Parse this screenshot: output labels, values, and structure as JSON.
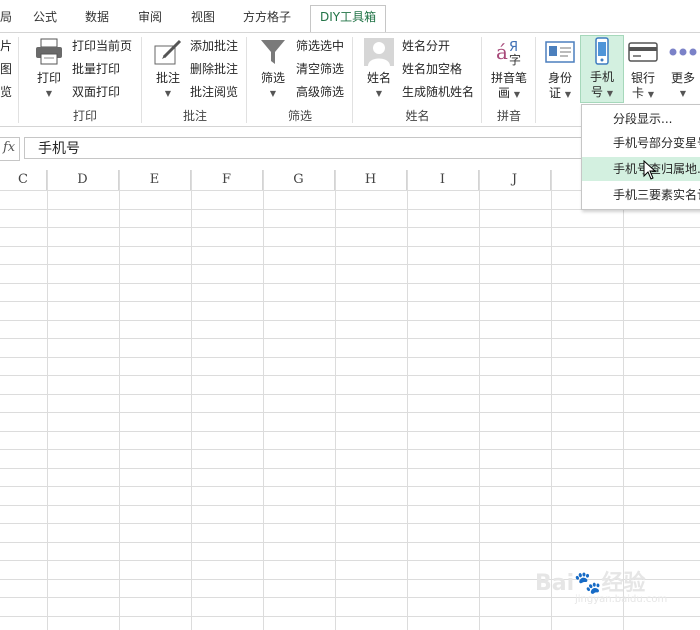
{
  "tabs": [
    "局",
    "公式",
    "数据",
    "审阅",
    "视图",
    "方方格子",
    "DIY工具箱"
  ],
  "ribbon": {
    "partial_items": [
      "片",
      "图",
      "览"
    ],
    "print": {
      "big": "打印",
      "items": [
        "打印当前页",
        "批量打印",
        "双面打印"
      ],
      "group": "打印"
    },
    "comment": {
      "big": "批注",
      "items": [
        "添加批注",
        "删除批注",
        "批注阅览"
      ],
      "group": "批注"
    },
    "filter": {
      "big": "筛选",
      "items": [
        "筛选选中",
        "清空筛选",
        "高级筛选"
      ],
      "group": "筛选"
    },
    "name": {
      "big": "姓名",
      "items": [
        "姓名分开",
        "姓名加空格",
        "生成随机姓名"
      ],
      "group": "姓名"
    },
    "pinyin": {
      "big_line1": "拼音笔",
      "big_line2": "画",
      "group": "拼音"
    },
    "idcard": {
      "line1": "身份",
      "line2": "证"
    },
    "phone": {
      "line1": "手机",
      "line2": "号"
    },
    "bank": {
      "line1": "银行",
      "line2": "卡"
    },
    "more": {
      "label": "更多"
    }
  },
  "formula_bar": {
    "fx": "fx",
    "value": "手机号"
  },
  "columns": [
    "C",
    "D",
    "E",
    "F",
    "G",
    "H",
    "I",
    "J"
  ],
  "dropdown": {
    "items": [
      "分段显示...",
      "手机号部分变星号",
      "手机号查归属地...",
      "手机三要素实名认证"
    ]
  },
  "watermark": {
    "main": "Bai🐾经验",
    "sub": "jingyan.baidu.com"
  }
}
